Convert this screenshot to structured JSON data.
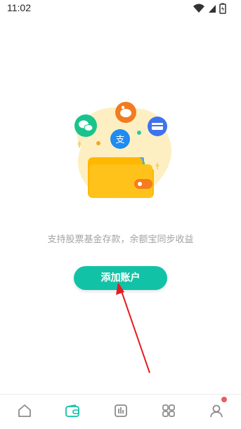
{
  "status_bar": {
    "time": "11:02"
  },
  "main": {
    "subtitle": "支持股票基金存款，余额宝同步收益",
    "add_button_label": "添加账户"
  },
  "bottom_nav": {
    "items": [
      {
        "id": "home",
        "icon": "home-icon"
      },
      {
        "id": "wallet",
        "icon": "wallet-icon",
        "active": true
      },
      {
        "id": "chart",
        "icon": "chart-icon"
      },
      {
        "id": "apps",
        "icon": "apps-icon"
      },
      {
        "id": "profile",
        "icon": "profile-icon",
        "badge": true
      }
    ]
  },
  "colors": {
    "accent": "#12c2a6",
    "badge": "#ef5a62",
    "subtitle_text": "#a3a3a3",
    "annotation_arrow": "#e51c23"
  }
}
